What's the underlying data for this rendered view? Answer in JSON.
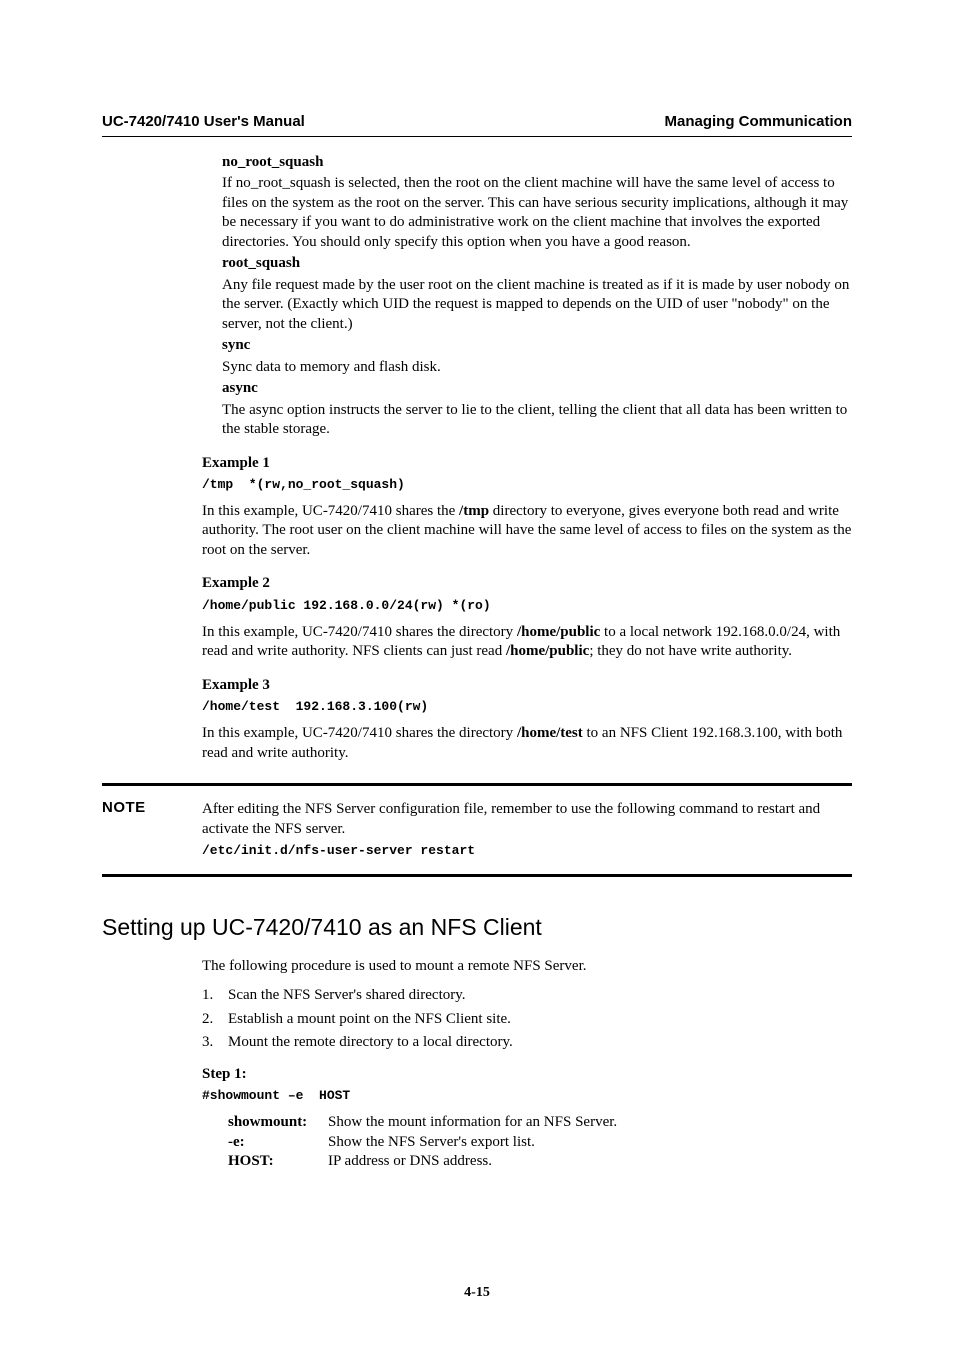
{
  "header": {
    "left": "UC-7420/7410 User's Manual",
    "right": "Managing Communication"
  },
  "options": {
    "no_root_squash": {
      "title": "no_root_squash",
      "body": "If no_root_squash is selected, then the root on the client machine will have the same level of access to files on the system as the root on the server. This can have serious security implications, although it may be necessary if you want to do administrative work on the client machine that involves the exported directories. You should only specify this option when you have a good reason."
    },
    "root_squash": {
      "title": "root_squash",
      "body": "Any file request made by the user root on the client machine is treated as if it is made by user nobody on the server. (Exactly which UID the request is mapped to depends on the UID of user \"nobody\" on the server, not the client.)"
    },
    "sync": {
      "title": "sync",
      "body": "Sync data to memory and flash disk."
    },
    "async": {
      "title": "async",
      "body": "The async option instructs the server to lie to the client, telling the client that all data has been written to the stable storage."
    }
  },
  "example1": {
    "title": "Example 1",
    "code": "/tmp  *(rw,no_root_squash)",
    "pre": "In this example, UC-7420/7410 shares the ",
    "bold1": "/tmp",
    "post": " directory to everyone, gives everyone both read and write authority. The root user on the client machine will have the same level of access to files on the system as the root on the server."
  },
  "example2": {
    "title": "Example 2",
    "code": "/home/public 192.168.0.0/24(rw) *(ro)",
    "pre": "In this example, UC-7420/7410 shares the directory ",
    "bold1": "/home/public",
    "mid": " to a local network 192.168.0.0/24, with read and write authority. NFS clients can just read ",
    "bold2": "/home/public",
    "post": "; they do not have write authority."
  },
  "example3": {
    "title": "Example 3",
    "code": "/home/test  192.168.3.100(rw)",
    "pre": "In this example, UC-7420/7410 shares the directory ",
    "bold1": "/home/test",
    "post": " to an NFS Client 192.168.3.100, with both read and write authority."
  },
  "note": {
    "label": "NOTE",
    "body": "After editing the NFS Server configuration file, remember to use the following command to restart and activate the NFS server.",
    "code": "/etc/init.d/nfs-user-server restart"
  },
  "section2": {
    "title": "Setting up UC-7420/7410 as an NFS Client",
    "intro": "The following procedure is used to mount a remote NFS Server.",
    "steps": [
      "Scan the NFS Server's shared directory.",
      "Establish a mount point on the NFS Client site.",
      "Mount the remote directory to a local directory."
    ],
    "step1_label": "Step 1:",
    "step1_code": "#showmount –e  HOST",
    "defs": [
      {
        "term": "showmount:",
        "desc": "Show the mount information for an NFS Server."
      },
      {
        "term": "-e:",
        "desc": "Show the NFS Server's export list."
      },
      {
        "term": "HOST:",
        "desc": "IP address or DNS address."
      }
    ]
  },
  "page_number": "4-15"
}
